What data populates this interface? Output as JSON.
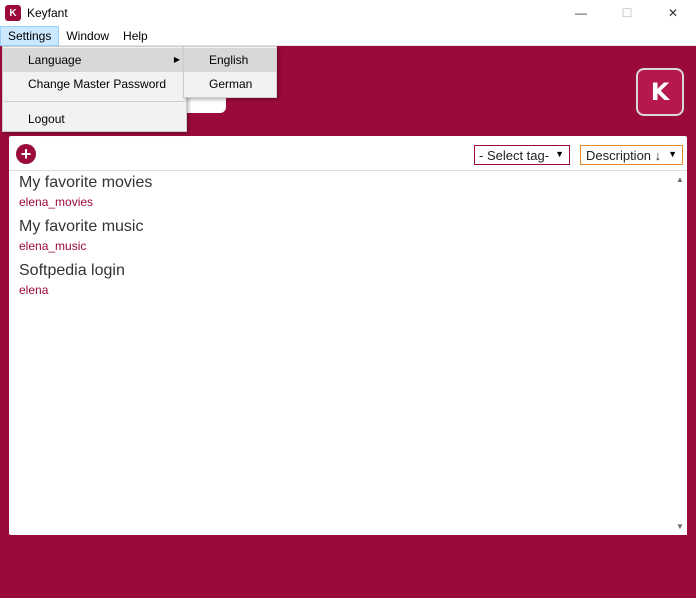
{
  "window": {
    "title": "Keyfant",
    "icon_letter": "K",
    "minimize": "—",
    "maximize": "☐",
    "close": "✕"
  },
  "menubar": {
    "items": [
      "Settings",
      "Window",
      "Help"
    ]
  },
  "settings_menu": {
    "language": "Language",
    "change_master_password": "Change Master Password",
    "logout": "Logout"
  },
  "language_submenu": {
    "items": [
      "English",
      "German"
    ]
  },
  "logo": {
    "glyph": "K"
  },
  "toolbar": {
    "add_symbol": "+",
    "tag_select": "- Select tag-",
    "sort_select": "Description ↓"
  },
  "entries": [
    {
      "title": "My favorite movies",
      "username": "elena_movies"
    },
    {
      "title": "My favorite music",
      "username": "elena_music"
    },
    {
      "title": "Softpedia login",
      "username": "elena"
    }
  ],
  "colors": {
    "brand": "#9b0a3c",
    "sort_border": "#e08a2a"
  }
}
